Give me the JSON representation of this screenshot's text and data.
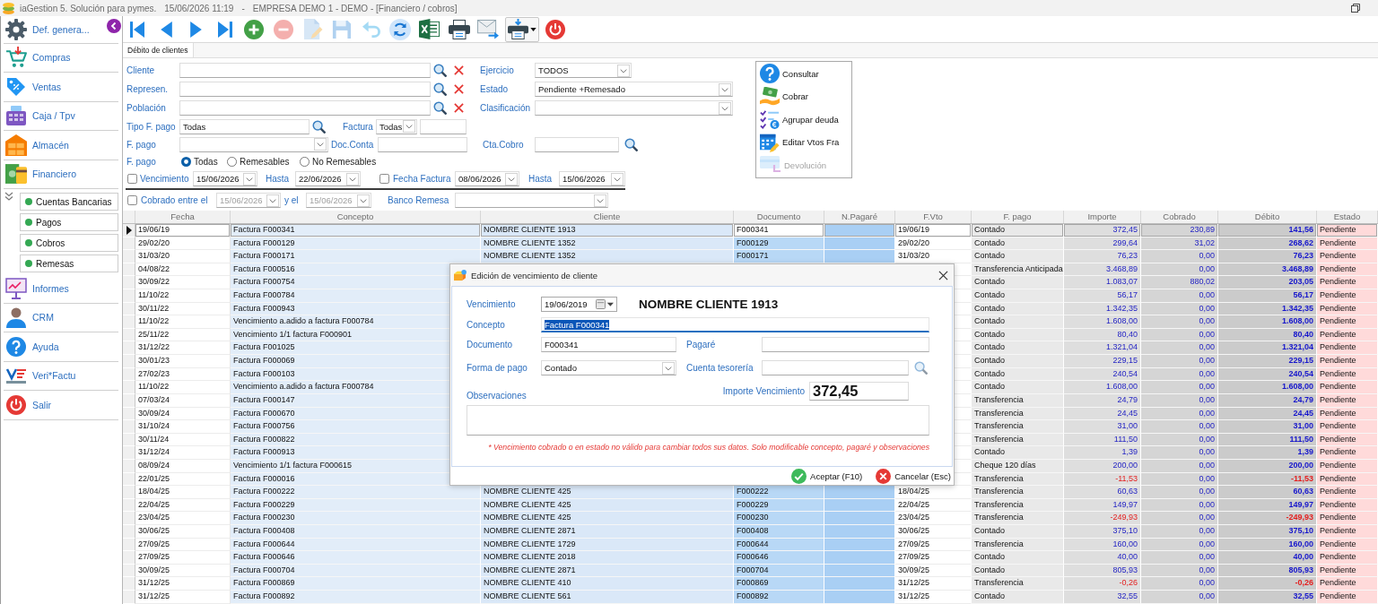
{
  "window": {
    "title_parts": [
      "iaGestion 5. Solución para pymes.",
      "15/06/2026 11:19",
      "-",
      "EMPRESA DEMO 1 - DEMO - [Financiero / cobros]"
    ]
  },
  "sidebar": {
    "items": [
      {
        "label": "Def. genera...",
        "kind": "settings"
      },
      {
        "label": "Compras",
        "kind": "purchases"
      },
      {
        "label": "Ventas",
        "kind": "sales"
      },
      {
        "label": "Caja / Tpv",
        "kind": "till"
      },
      {
        "label": "Almacén",
        "kind": "warehouse"
      },
      {
        "label": "Financiero",
        "kind": "finance",
        "children": [
          {
            "label": "Cuentas Bancarias"
          },
          {
            "label": "Pagos"
          },
          {
            "label": "Cobros"
          },
          {
            "label": "Remesas"
          }
        ]
      },
      {
        "label": "Informes",
        "kind": "reports"
      },
      {
        "label": "CRM",
        "kind": "crm"
      },
      {
        "label": "Ayuda",
        "kind": "help"
      },
      {
        "label": "Veri*Factu",
        "kind": "verifactu"
      },
      {
        "label": "Salir",
        "kind": "exit"
      }
    ]
  },
  "toolbar": [
    {
      "kind": "first",
      "disabled": false
    },
    {
      "kind": "prev",
      "disabled": false
    },
    {
      "kind": "next",
      "disabled": false
    },
    {
      "kind": "last",
      "disabled": false
    },
    {
      "kind": "add",
      "disabled": false
    },
    {
      "kind": "remove",
      "disabled": true
    },
    {
      "kind": "edit",
      "disabled": true
    },
    {
      "kind": "save",
      "disabled": true
    },
    {
      "kind": "undo",
      "disabled": true
    },
    {
      "kind": "refresh",
      "disabled": false
    },
    {
      "kind": "excel",
      "disabled": false
    },
    {
      "kind": "print",
      "disabled": false
    },
    {
      "kind": "email",
      "disabled": false
    },
    {
      "kind": "printmenu",
      "disabled": false
    },
    {
      "kind": "exit",
      "disabled": false
    }
  ],
  "tabs": [
    {
      "label": "Débito de clientes",
      "selected": true
    }
  ],
  "filters": {
    "cliente": {
      "label": "Cliente"
    },
    "ejercicio": {
      "label": "Ejercicio",
      "value": "TODOS"
    },
    "represen": {
      "label": "Represen."
    },
    "estado": {
      "label": "Estado",
      "value": "Pendiente +Remesado"
    },
    "poblacion": {
      "label": "Población"
    },
    "clasificacion": {
      "label": "Clasificación"
    },
    "tipo_f_pago": {
      "label": "Tipo F. pago",
      "value": "Todas"
    },
    "factura": {
      "label": "Factura",
      "value": "Todas"
    },
    "f_pago": {
      "label": "F. pago"
    },
    "doc_conta": {
      "label": "Doc.Conta"
    },
    "cta_cobro": {
      "label": "Cta.Cobro"
    },
    "f_pago_tipo": {
      "label": "F. pago",
      "options": [
        {
          "label": "Todas",
          "selected": true
        },
        {
          "label": "Remesables",
          "selected": false
        },
        {
          "label": "No Remesables",
          "selected": false
        }
      ]
    },
    "vencimiento": {
      "label": "Vencimiento",
      "checked": false,
      "disabled": false,
      "from": "15/06/2026",
      "to_label": "Hasta",
      "to": "22/06/2026"
    },
    "fecha_factura": {
      "label": "Fecha Factura",
      "checked": false,
      "disabled": false,
      "from": "08/06/2026",
      "to_label": "Hasta",
      "to": "15/06/2026"
    },
    "cobrado": {
      "label": "Cobrado entre el",
      "checked": false,
      "disabled": true,
      "from": "15/06/2026",
      "to_label": "y el",
      "to": "15/06/2026"
    },
    "banco_remesa": {
      "label": "Banco Remesa"
    }
  },
  "actions": [
    {
      "label": "Consultar",
      "kind": "consult",
      "disabled": false
    },
    {
      "label": "Cobrar",
      "kind": "collect",
      "disabled": false
    },
    {
      "label": "Agrupar deuda",
      "kind": "group",
      "disabled": false
    },
    {
      "label": "Editar Vtos Fra",
      "kind": "edit_dates",
      "disabled": false
    },
    {
      "label": "Devolución",
      "kind": "refund",
      "disabled": true
    }
  ],
  "table": {
    "columns": [
      "Fecha",
      "Concepto",
      "Cliente",
      "Documento",
      "N.Pagaré",
      "F.Vto",
      "F. pago",
      "Importe",
      "Cobrado",
      "Débito",
      "Estado"
    ],
    "rows": [
      {
        "fecha": "19/06/19",
        "concepto": "Factura F000341",
        "cliente": "NOMBRE CLIENTE 1913",
        "documento": "F000341",
        "f_vto": "19/06/19",
        "f_pago": "Contado",
        "importe": "372,45",
        "cobrado": "230,89",
        "debito": "141,56",
        "estado": "Pendiente",
        "negative": false,
        "selected": true
      },
      {
        "fecha": "29/02/20",
        "concepto": "Factura F000129",
        "cliente": "NOMBRE CLIENTE 1352",
        "documento": "F000129",
        "f_vto": "29/02/20",
        "f_pago": "Contado",
        "importe": "299,64",
        "cobrado": "31,02",
        "debito": "268,62",
        "estado": "Pendiente",
        "negative": false,
        "selected": false
      },
      {
        "fecha": "31/03/20",
        "concepto": "Factura F000171",
        "cliente": "NOMBRE CLIENTE 1352",
        "documento": "F000171",
        "f_vto": "31/03/20",
        "f_pago": "Contado",
        "importe": "76,23",
        "cobrado": "0,00",
        "debito": "76,23",
        "estado": "Pendiente",
        "negative": false,
        "selected": false
      },
      {
        "fecha": "04/08/22",
        "concepto": "Factura F000516",
        "f_pago": "Transferencia Anticipada",
        "importe": "3.468,89",
        "cobrado": "0,00",
        "debito": "3.468,89",
        "estado": "Pendiente",
        "negative": false,
        "selected": false
      },
      {
        "fecha": "30/09/22",
        "concepto": "Factura F000754",
        "f_pago": "Contado",
        "importe": "1.083,07",
        "cobrado": "880,02",
        "debito": "203,05",
        "estado": "Pendiente",
        "negative": false,
        "selected": false
      },
      {
        "fecha": "11/10/22",
        "concepto": "Factura F000784",
        "f_pago": "Contado",
        "importe": "56,17",
        "cobrado": "0,00",
        "debito": "56,17",
        "estado": "Pendiente",
        "negative": false,
        "selected": false
      },
      {
        "fecha": "30/11/22",
        "concepto": "Factura F000943",
        "f_pago": "Contado",
        "importe": "1.342,35",
        "cobrado": "0,00",
        "debito": "1.342,35",
        "estado": "Pendiente",
        "negative": false,
        "selected": false
      },
      {
        "fecha": "11/10/22",
        "concepto": "Vencimiento a.adido a factura F000784",
        "f_pago": "Contado",
        "importe": "1.608,00",
        "cobrado": "0,00",
        "debito": "1.608,00",
        "estado": "Pendiente",
        "negative": false,
        "selected": false
      },
      {
        "fecha": "25/11/22",
        "concepto": "Vencimiento 1/1 factura F000901",
        "f_pago": "Contado",
        "importe": "80,40",
        "cobrado": "0,00",
        "debito": "80,40",
        "estado": "Pendiente",
        "negative": false,
        "selected": false
      },
      {
        "fecha": "31/12/22",
        "concepto": "Factura F001025",
        "f_pago": "Contado",
        "importe": "1.321,04",
        "cobrado": "0,00",
        "debito": "1.321,04",
        "estado": "Pendiente",
        "negative": false,
        "selected": false
      },
      {
        "fecha": "30/01/23",
        "concepto": "Factura F000069",
        "f_pago": "Contado",
        "importe": "229,15",
        "cobrado": "0,00",
        "debito": "229,15",
        "estado": "Pendiente",
        "negative": false,
        "selected": false
      },
      {
        "fecha": "27/02/23",
        "concepto": "Factura F000103",
        "f_pago": "Contado",
        "importe": "240,54",
        "cobrado": "0,00",
        "debito": "240,54",
        "estado": "Pendiente",
        "negative": false,
        "selected": false
      },
      {
        "fecha": "11/10/22",
        "concepto": "Vencimiento a.adido a factura F000784",
        "f_pago": "Contado",
        "importe": "1.608,00",
        "cobrado": "0,00",
        "debito": "1.608,00",
        "estado": "Pendiente",
        "negative": false,
        "selected": false
      },
      {
        "fecha": "07/03/24",
        "concepto": "Factura F000147",
        "f_pago": "Transferencia",
        "importe": "24,79",
        "cobrado": "0,00",
        "debito": "24,79",
        "estado": "Pendiente",
        "negative": false,
        "selected": false
      },
      {
        "fecha": "30/09/24",
        "concepto": "Factura F000670",
        "f_pago": "Transferencia",
        "importe": "24,45",
        "cobrado": "0,00",
        "debito": "24,45",
        "estado": "Pendiente",
        "negative": false,
        "selected": false
      },
      {
        "fecha": "31/10/24",
        "concepto": "Factura F000756",
        "f_pago": "Transferencia",
        "importe": "31,00",
        "cobrado": "0,00",
        "debito": "31,00",
        "estado": "Pendiente",
        "negative": false,
        "selected": false
      },
      {
        "fecha": "30/11/24",
        "concepto": "Factura F000822",
        "f_pago": "Transferencia",
        "importe": "111,50",
        "cobrado": "0,00",
        "debito": "111,50",
        "estado": "Pendiente",
        "negative": false,
        "selected": false
      },
      {
        "fecha": "31/12/24",
        "concepto": "Factura F000913",
        "f_pago": "Contado",
        "importe": "1,39",
        "cobrado": "0,00",
        "debito": "1,39",
        "estado": "Pendiente",
        "negative": false,
        "selected": false
      },
      {
        "fecha": "08/09/24",
        "concepto": "Vencimiento 1/1 factura F000615",
        "f_pago": "Cheque 120 días",
        "importe": "200,00",
        "cobrado": "0,00",
        "debito": "200,00",
        "estado": "Pendiente",
        "negative": false,
        "selected": false
      },
      {
        "fecha": "22/01/25",
        "concepto": "Factura F000016",
        "f_pago": "Transferencia",
        "importe": "-11,53",
        "cobrado": "0,00",
        "debito": "-11,53",
        "estado": "Pendiente",
        "negative": true,
        "selected": false
      },
      {
        "fecha": "18/04/25",
        "concepto": "Factura F000222",
        "cliente": "NOMBRE CLIENTE 425",
        "documento": "F000222",
        "f_vto": "18/04/25",
        "f_pago": "Transferencia",
        "importe": "60,63",
        "cobrado": "0,00",
        "debito": "60,63",
        "estado": "Pendiente",
        "negative": false,
        "selected": false
      },
      {
        "fecha": "22/04/25",
        "concepto": "Factura F000229",
        "cliente": "NOMBRE CLIENTE 425",
        "documento": "F000229",
        "f_vto": "22/04/25",
        "f_pago": "Transferencia",
        "importe": "149,97",
        "cobrado": "0,00",
        "debito": "149,97",
        "estado": "Pendiente",
        "negative": false,
        "selected": false
      },
      {
        "fecha": "23/04/25",
        "concepto": "Factura F000230",
        "cliente": "NOMBRE CLIENTE 425",
        "documento": "F000230",
        "f_vto": "23/04/25",
        "f_pago": "Transferencia",
        "importe": "-249,93",
        "cobrado": "0,00",
        "debito": "-249,93",
        "estado": "Pendiente",
        "negative": true,
        "selected": false
      },
      {
        "fecha": "30/06/25",
        "concepto": "Factura F000408",
        "cliente": "NOMBRE CLIENTE 2871",
        "documento": "F000408",
        "f_vto": "30/06/25",
        "f_pago": "Contado",
        "importe": "375,10",
        "cobrado": "0,00",
        "debito": "375,10",
        "estado": "Pendiente",
        "negative": false,
        "selected": false
      },
      {
        "fecha": "27/09/25",
        "concepto": "Factura F000644",
        "cliente": "NOMBRE CLIENTE 1729",
        "documento": "F000644",
        "f_vto": "27/09/25",
        "f_pago": "Transferencia",
        "importe": "160,00",
        "cobrado": "0,00",
        "debito": "160,00",
        "estado": "Pendiente",
        "negative": false,
        "selected": false
      },
      {
        "fecha": "27/09/25",
        "concepto": "Factura F000646",
        "cliente": "NOMBRE CLIENTE 2018",
        "documento": "F000646",
        "f_vto": "27/09/25",
        "f_pago": "Contado",
        "importe": "40,00",
        "cobrado": "0,00",
        "debito": "40,00",
        "estado": "Pendiente",
        "negative": false,
        "selected": false
      },
      {
        "fecha": "30/09/25",
        "concepto": "Factura F000704",
        "cliente": "NOMBRE CLIENTE 2871",
        "documento": "F000704",
        "f_vto": "30/09/25",
        "f_pago": "Contado",
        "importe": "805,93",
        "cobrado": "0,00",
        "debito": "805,93",
        "estado": "Pendiente",
        "negative": false,
        "selected": false
      },
      {
        "fecha": "31/12/25",
        "concepto": "Factura F000869",
        "cliente": "NOMBRE CLIENTE 410",
        "documento": "F000869",
        "f_vto": "31/12/25",
        "f_pago": "Transferencia",
        "importe": "-0,26",
        "cobrado": "0,00",
        "debito": "-0,26",
        "estado": "Pendiente",
        "negative": true,
        "selected": false
      },
      {
        "fecha": "31/12/25",
        "concepto": "Factura F000892",
        "cliente": "NOMBRE CLIENTE 561",
        "documento": "F000892",
        "f_vto": "31/12/25",
        "f_pago": "Contado",
        "importe": "32,55",
        "cobrado": "0,00",
        "debito": "32,55",
        "estado": "Pendiente",
        "negative": false,
        "selected": false
      }
    ]
  },
  "dialog": {
    "title": "Edición de vencimiento de cliente",
    "vencimiento": {
      "label": "Vencimiento",
      "value": "19/06/2019"
    },
    "client_name": "NOMBRE CLIENTE 1913",
    "concepto": {
      "label": "Concepto",
      "value": "Factura F000341",
      "focused": true
    },
    "documento": {
      "label": "Documento",
      "value": "F000341"
    },
    "pagare": {
      "label": "Pagaré"
    },
    "forma_pago": {
      "label": "Forma de pago",
      "value": "Contado"
    },
    "cuenta_tesoreria": {
      "label": "Cuenta tesorería"
    },
    "observaciones": {
      "label": "Observaciones"
    },
    "importe": {
      "label": "Importe Vencimiento",
      "value": "372,45"
    },
    "note": "* Vencimiento cobrado o en estado no válido para cambiar todos sus datos. Solo modificable concepto, pagaré y observaciones",
    "buttons": [
      {
        "label": "Aceptar (F10)",
        "kind": "accept"
      },
      {
        "label": "Cancelar (Esc)",
        "kind": "cancel"
      }
    ]
  }
}
